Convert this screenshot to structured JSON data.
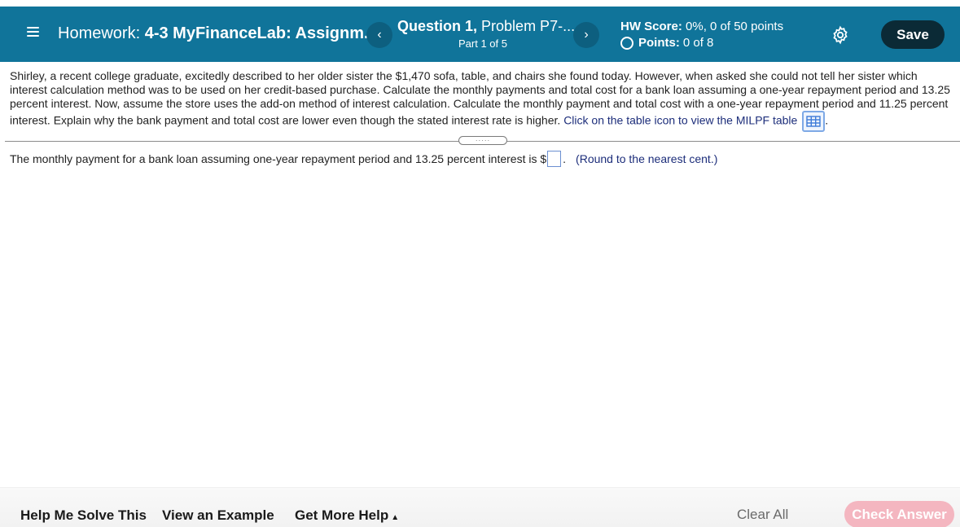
{
  "header": {
    "title_prefix": "Homework:",
    "title_name": "4-3 MyFinanceLab: Assignm...",
    "prev_icon": "‹",
    "next_icon": "›",
    "question_label": "Question 1,",
    "problem_label": "Problem P7-...",
    "part_label": "Part 1 of 5",
    "hw_score_label": "HW Score:",
    "hw_score_value": "0%, 0 of 50 points",
    "points_label": "Points:",
    "points_value": "0 of 8",
    "save_label": "Save"
  },
  "question": {
    "text": "Shirley, a recent college graduate, excitedly described to her older sister the $1,470 sofa, table, and chairs she found today. However, when asked she could not tell her sister which interest calculation method was to be used on her credit-based purchase. Calculate the monthly payments and total cost for a bank loan assuming a one-year repayment period and 13.25 percent interest. Now, assume the store uses the add-on method of interest calculation. Calculate the monthly payment and total cost with a one-year repayment period and 11.25 percent interest. Explain why the bank payment and total cost are lower even though the stated interest rate is higher.",
    "link_text": "Click on the table icon to view the MILPF table",
    "trailing": "."
  },
  "answer": {
    "prompt": "The monthly payment for a bank loan assuming one-year repayment period and 13.25 percent interest is $",
    "input_value": "",
    "after_input": ".",
    "note": "(Round to the nearest cent.)"
  },
  "footer": {
    "help_solve": "Help Me Solve This",
    "view_example": "View an Example",
    "more_help": "Get More Help",
    "more_help_caret": "▲",
    "clear_all": "Clear All",
    "check_answer": "Check Answer"
  },
  "colors": {
    "header_bg": "#10749a",
    "save_bg": "#0b2a36",
    "link": "#1c2d7a",
    "check_answer_disabled": "#f4b6c0"
  },
  "icons": [
    "hamburger-menu-icon",
    "chevron-left-icon",
    "chevron-right-icon",
    "points-ring-icon",
    "gear-icon",
    "table-grid-icon",
    "caret-up-icon"
  ]
}
